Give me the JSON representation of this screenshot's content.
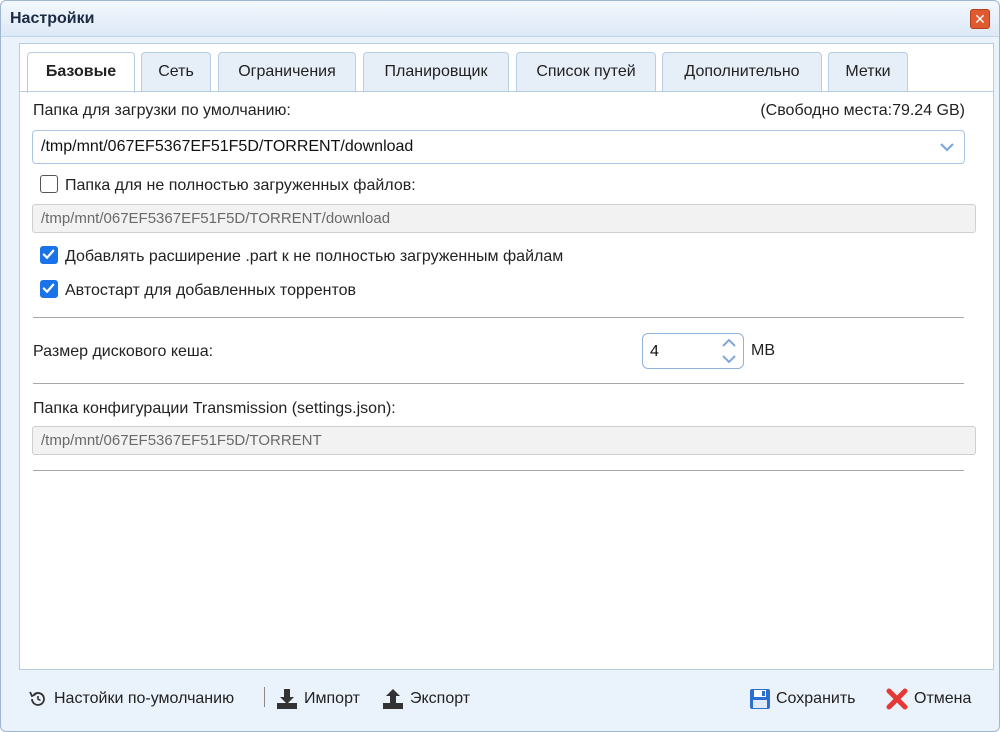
{
  "window": {
    "title": "Настройки",
    "close_label": "✕"
  },
  "tabs": [
    {
      "label": "Базовые",
      "active": true
    },
    {
      "label": "Сеть",
      "active": false
    },
    {
      "label": "Ограничения",
      "active": false
    },
    {
      "label": "Планировщик",
      "active": false
    },
    {
      "label": "Список путей",
      "active": false
    },
    {
      "label": "Дополнительно",
      "active": false
    },
    {
      "label": "Метки",
      "active": false
    }
  ],
  "base": {
    "download_folder_label": "Папка для загрузки по умолчанию:",
    "free_space": "(Свободно места:79.24 GB)",
    "download_folder_value": "/tmp/mnt/067EF5367EF51F5D/TORRENT/download",
    "incomplete_folder_label": "Папка для не полностью загруженных файлов:",
    "incomplete_folder_checked": false,
    "incomplete_folder_value": "/tmp/mnt/067EF5367EF51F5D/TORRENT/download",
    "part_ext_label": "Добавлять расширение .part к не полностью загруженным файлам",
    "part_ext_checked": true,
    "autostart_label": "Автостарт для добавленных торрентов",
    "autostart_checked": true,
    "cache_label": "Размер дискового кеша:",
    "cache_value": "4",
    "cache_unit": "MB",
    "config_folder_label": "Папка конфигурации Transmission (settings.json):",
    "config_folder_value": "/tmp/mnt/067EF5367EF51F5D/TORRENT"
  },
  "footer": {
    "defaults_label": "Настойки по-умолчанию",
    "import_label": "Импорт",
    "export_label": "Экспорт",
    "save_label": "Сохранить",
    "cancel_label": "Отмена"
  },
  "colors": {
    "accent": "#1a73e8",
    "close": "#e05a2f",
    "cancel_icon": "#e53935",
    "save_icon": "#2d6fd1"
  }
}
